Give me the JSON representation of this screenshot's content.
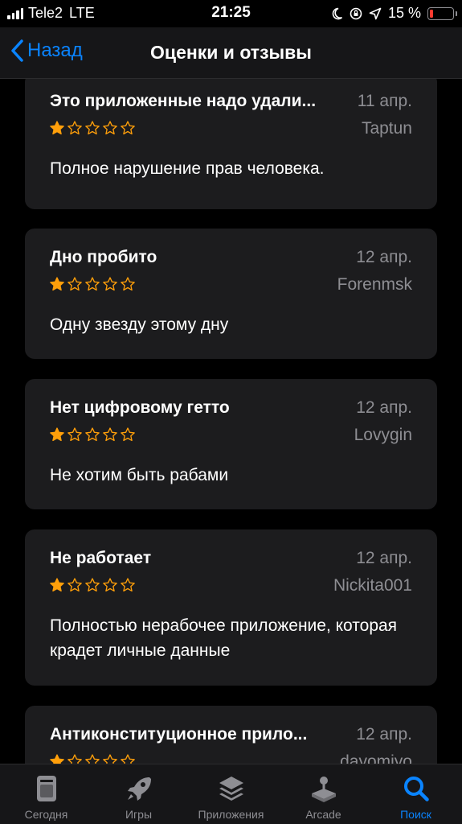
{
  "status": {
    "carrier": "Tele2",
    "network": "LTE",
    "time": "21:25",
    "battery": "15 %",
    "battery_level": 0.15
  },
  "nav": {
    "back_label": "Назад",
    "title": "Оценки и отзывы"
  },
  "reviews": [
    {
      "title": "Это приложенные надо удали...",
      "date": "11 апр.",
      "author": "Taptun",
      "rating": 1,
      "body": "Полное нарушение прав человека."
    },
    {
      "title": "Дно пробито",
      "date": "12 апр.",
      "author": "Forenmsk",
      "rating": 1,
      "body": "Одну звезду этому дну"
    },
    {
      "title": "Нет цифровому гетто",
      "date": "12 апр.",
      "author": "Lovygin",
      "rating": 1,
      "body": "Не хотим быть рабами"
    },
    {
      "title": "Не работает",
      "date": "12 апр.",
      "author": "Nickita001",
      "rating": 1,
      "body": "Полностью нерабочее приложение, которая крадет личные данные"
    },
    {
      "title": "Антиконституционное прило...",
      "date": "12 апр.",
      "author": "dayomiyo",
      "rating": 1,
      "body": ""
    }
  ],
  "tabs": [
    {
      "label": "Сегодня",
      "icon": "today-icon",
      "active": false
    },
    {
      "label": "Игры",
      "icon": "rocket-icon",
      "active": false
    },
    {
      "label": "Приложения",
      "icon": "apps-layers-icon",
      "active": false
    },
    {
      "label": "Arcade",
      "icon": "arcade-joystick-icon",
      "active": false
    },
    {
      "label": "Поиск",
      "icon": "search-icon",
      "active": true
    }
  ],
  "colors": {
    "accent": "#0a84ff",
    "star": "#ff9f0a",
    "card": "#1c1c1e",
    "secondary_text": "#8e8e93",
    "battery_low": "#ff3b30"
  }
}
